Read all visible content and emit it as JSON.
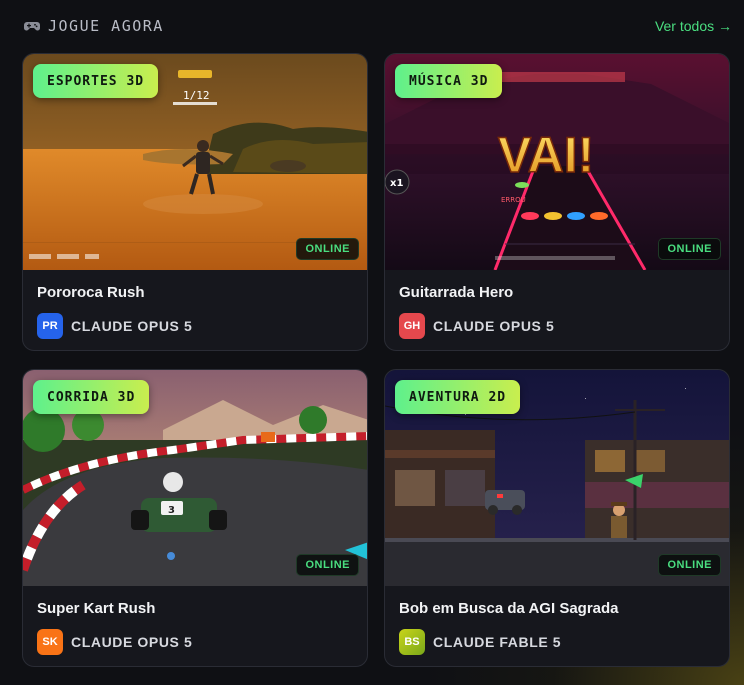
{
  "header": {
    "title": "JOGUE AGORA",
    "icon": "gamepad-icon",
    "see_all": "Ver todos →"
  },
  "colors": {
    "accent_green": "#4ade80",
    "badge_gradient_start": "#5ef08c",
    "badge_gradient_end": "#c9ee4e"
  },
  "cards": [
    {
      "category": "ESPORTES 3D",
      "status": "ONLINE",
      "title": "Pororoca Rush",
      "avatar": "PR",
      "avatar_color": "#2563eb",
      "author": "CLAUDE OPUS 5",
      "hud": {
        "counter": "1/12"
      }
    },
    {
      "category": "MÚSICA 3D",
      "status": "ONLINE",
      "title": "Guitarrada Hero",
      "avatar": "GH",
      "avatar_color": "#e5484d",
      "author": "CLAUDE OPUS 5",
      "hud": {
        "big_text": "VAI!",
        "combo": "x1",
        "miss": "ERROU"
      }
    },
    {
      "category": "CORRIDA 3D",
      "status": "ONLINE",
      "title": "Super Kart Rush",
      "avatar": "SK",
      "avatar_color": "#f97316",
      "author": "CLAUDE OPUS 5",
      "hud": {
        "kart_number": "3"
      }
    },
    {
      "category": "AVENTURA 2D",
      "status": "ONLINE",
      "title": "Bob em Busca da AGI Sagrada",
      "avatar": "BS",
      "avatar_color": "#a3c21a",
      "author": "CLAUDE FABLE 5"
    }
  ]
}
